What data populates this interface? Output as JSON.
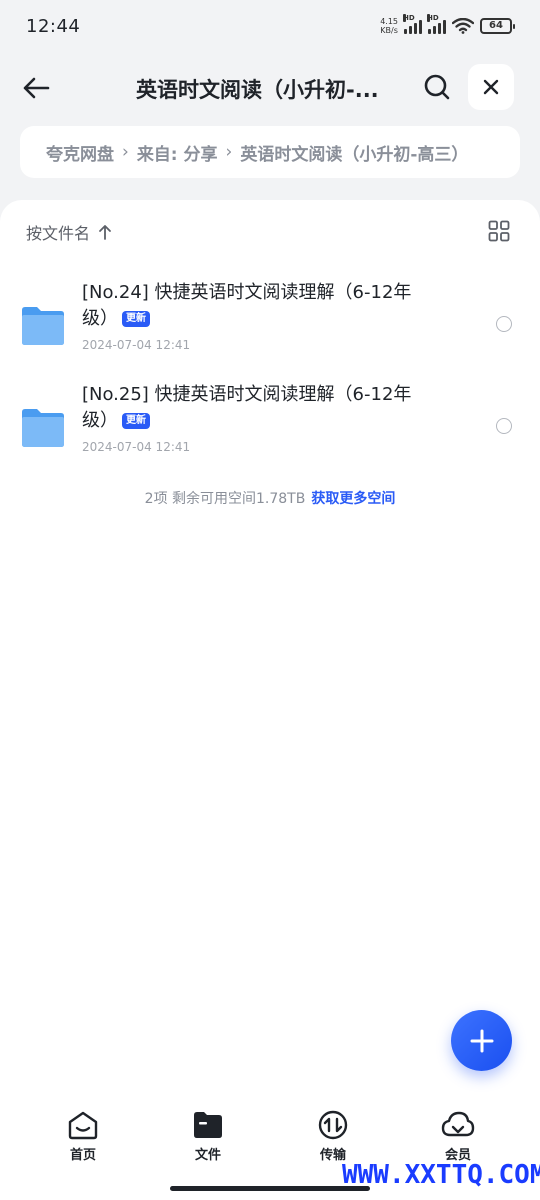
{
  "status_bar": {
    "time": "12:44",
    "net_speed_value": "4.15",
    "net_speed_unit": "KB/s",
    "hd_label_1": "HD",
    "hd_label_2": "HD",
    "battery": "64"
  },
  "header": {
    "title": "英语时文阅读（小升初-...",
    "back_icon": "arrow-left-icon",
    "search_icon": "search-icon",
    "close_icon": "close-icon"
  },
  "breadcrumb": {
    "items": [
      "夸克网盘",
      "来自: 分享",
      "英语时文阅读（小升初-高三）"
    ]
  },
  "toolbar": {
    "sort_label": "按文件名",
    "sort_icon": "arrow-up-icon",
    "view_icon": "grid-view-icon"
  },
  "files": [
    {
      "name": "[No.24] 快捷英语时文阅读理解（6-12年级）",
      "badge": "更新",
      "date": "2024-07-04 12:41"
    },
    {
      "name": "[No.25] 快捷英语时文阅读理解（6-12年级）",
      "badge": "更新",
      "date": "2024-07-04 12:41"
    }
  ],
  "footer": {
    "summary": "2项 剩余可用空间1.78TB",
    "link": "获取更多空间"
  },
  "bottom_nav": [
    {
      "label": "首页",
      "icon": "home-icon"
    },
    {
      "label": "文件",
      "icon": "folder-icon"
    },
    {
      "label": "传输",
      "icon": "transfer-icon"
    },
    {
      "label": "会员",
      "icon": "cloud-icon"
    }
  ],
  "watermark": "WWW.XXTTQ.COM",
  "colors": {
    "accent": "#2a5bf6",
    "background": "#f2f3f5",
    "text": "#1f2329"
  }
}
